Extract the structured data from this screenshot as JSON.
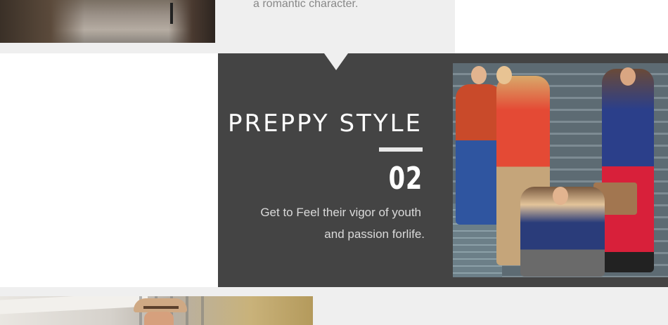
{
  "top_section": {
    "caption": "a romantic character."
  },
  "feature": {
    "title": "PREPPY STYLE",
    "number": "02",
    "description_line1": "Get to Feel their vigor of youth",
    "description_line2": "and passion forlife."
  },
  "colors": {
    "panel_background": "#444444",
    "section_background": "#efefef",
    "title_text": "#ffffff",
    "body_text": "#dadada",
    "caption_text": "#888888"
  }
}
